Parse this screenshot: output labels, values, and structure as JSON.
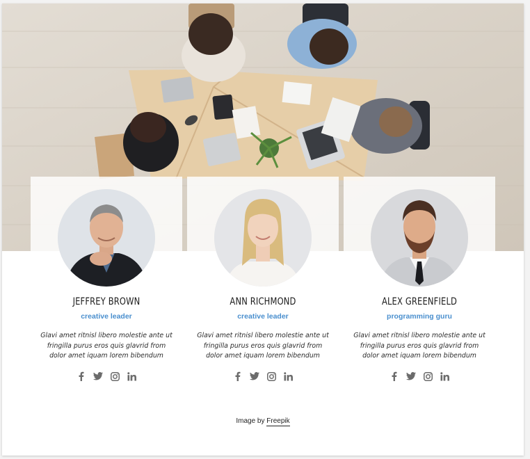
{
  "hero": {
    "description_icon": "office-meeting-photo"
  },
  "team": [
    {
      "name": "JEFFREY BROWN",
      "role": "creative leader",
      "bio": "Glavi amet ritnisl libero molestie ante ut fringilla purus eros quis glavrid from dolor amet iquam lorem bibendum",
      "socials": [
        "facebook-icon",
        "twitter-icon",
        "instagram-icon",
        "linkedin-icon"
      ]
    },
    {
      "name": "ANN RICHMOND",
      "role": "creative leader",
      "bio": "Glavi amet ritnisl libero molestie ante ut fringilla purus eros quis glavrid from dolor amet iquam lorem bibendum",
      "socials": [
        "facebook-icon",
        "twitter-icon",
        "instagram-icon",
        "linkedin-icon"
      ]
    },
    {
      "name": "ALEX GREENFIELD",
      "role": "programming guru",
      "bio": "Glavi amet ritnisl libero molestie ante ut fringilla purus eros quis glavrid from dolor amet iquam lorem bibendum",
      "socials": [
        "facebook-icon",
        "twitter-icon",
        "instagram-icon",
        "linkedin-icon"
      ]
    }
  ],
  "credit": {
    "prefix": "Image by ",
    "link": "Freepik"
  },
  "colors": {
    "accent": "#4a8fce",
    "icon": "#6b6b6b",
    "floor": "#d9d2c7",
    "table": "#e2c9a3"
  }
}
